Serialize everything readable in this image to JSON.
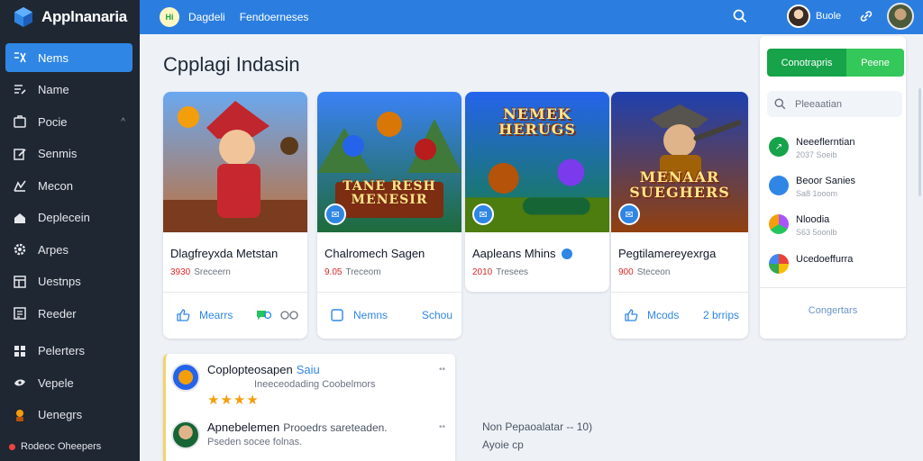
{
  "brand": {
    "name": "Applnanaria"
  },
  "sidebar": {
    "items": [
      {
        "label": "Nems",
        "icon": "apps-icon",
        "active": true
      },
      {
        "label": "Name",
        "icon": "edit-list-icon"
      },
      {
        "label": "Pocie",
        "icon": "home-icon",
        "caret": "^"
      },
      {
        "label": "Senmis",
        "icon": "edit-icon"
      },
      {
        "label": "Mecon",
        "icon": "people-icon"
      },
      {
        "label": "Deplecein",
        "icon": "house-icon"
      },
      {
        "label": "Arpes",
        "icon": "gear-icon"
      },
      {
        "label": "Uestnps",
        "icon": "window-icon"
      },
      {
        "label": "Reeder",
        "icon": "reader-icon"
      },
      {
        "label": "Pelerters",
        "icon": "grid-icon"
      },
      {
        "label": "Vepele",
        "icon": "globe-icon"
      },
      {
        "label": "Uenegrs",
        "icon": "character-icon"
      }
    ],
    "footer": "Rodeoc Oheepers"
  },
  "topbar": {
    "logo_text": "Hi",
    "link1": "Dagdeli",
    "link2": "Fendoerneses",
    "user_name": "Buole"
  },
  "main": {
    "title": "Cpplagi Indasin",
    "cards": [
      {
        "title": "Dlagfreyxda Metstan",
        "meta_red": "3930",
        "meta": "Sreceern",
        "foot_left": "Mearrs",
        "foot_right": "",
        "has_badge": false,
        "art_text": ""
      },
      {
        "title": "Chalromech Sagen",
        "meta_red": "9.05",
        "meta": "Treceom",
        "foot_left": "Nemns",
        "foot_right": "Schou",
        "has_badge": true,
        "art_text": "TANE RESH\nMENESIR"
      },
      {
        "title": "Aapleans Mhins",
        "meta_red": "2010",
        "meta": "Tresees",
        "foot_left": "",
        "foot_right": "",
        "has_badge": true,
        "art_text": "NEMEK\nHERUGS"
      },
      {
        "title": "Pegtilamereyexrga",
        "meta_red": "900",
        "meta": "Steceon",
        "foot_left": "Mcods",
        "foot_right": "2 brrips",
        "has_badge": true,
        "art_text": "MENAAR\nSUEGHERS"
      }
    ]
  },
  "right_panel": {
    "toggle": [
      "Conotrapris",
      "Peene"
    ],
    "search_placeholder": "Pleeaatian",
    "items": [
      {
        "title": "Neeeflerntian",
        "sub": "2037 Soeib",
        "color": "#16a34a"
      },
      {
        "title": "Beoor Sanies",
        "sub": "Sa8 1ooom",
        "color": "#2f86e5"
      },
      {
        "title": "Nloodia",
        "sub": "S63 5oonlb",
        "color": "#a855f7"
      },
      {
        "title": "Ucedoeffurra",
        "sub": "",
        "color": "#ea4335"
      }
    ],
    "link": "Congertars"
  },
  "feed": {
    "items": [
      {
        "title": "Coplopteosapen",
        "tag": "Saiu",
        "sub": "Ineeceodading Coobelmors",
        "stars": "★★★★"
      },
      {
        "title": "Apnebelemen",
        "tag": "Prooedrs sareteaden.",
        "sub": "Pseden socee folnas."
      }
    ]
  },
  "note": {
    "line1": "Non Pepaoalatar -- 10)",
    "line2": "Ayoie cp"
  },
  "colors": {
    "accent": "#2f86e5",
    "sidebar": "#1f2733",
    "green": "#16a34a"
  }
}
